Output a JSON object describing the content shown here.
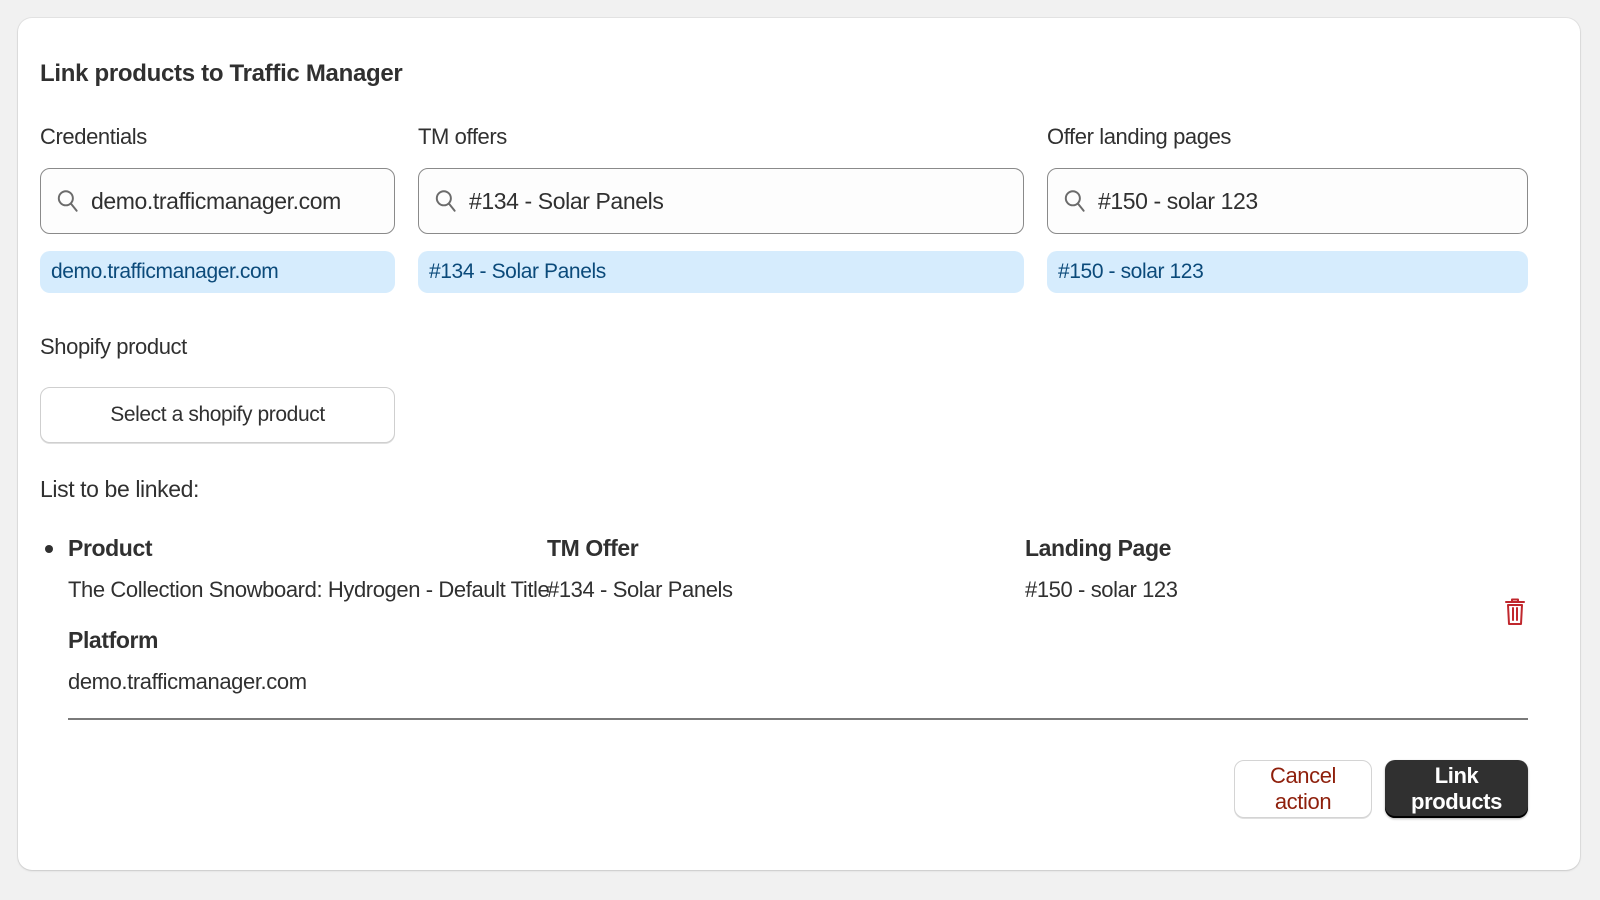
{
  "title": "Link products to Traffic Manager",
  "credentials": {
    "label": "Credentials",
    "search_value": "demo.trafficmanager.com",
    "selected_option": "demo.trafficmanager.com",
    "search_icon": "search-icon"
  },
  "tm_offers": {
    "label": "TM offers",
    "search_value": "#134 - Solar Panels",
    "selected_option": "#134 - Solar Panels",
    "search_icon": "search-icon"
  },
  "landing_pages": {
    "label": "Offer landing pages",
    "search_value": "#150 - solar 123",
    "selected_option": "#150 - solar 123",
    "search_icon": "search-icon"
  },
  "shopify_product": {
    "label": "Shopify product",
    "button_label": "Select a shopify product"
  },
  "link_list": {
    "title": "List to be linked:",
    "items": [
      {
        "product_header": "Product",
        "product": "The Collection Snowboard: Hydrogen - Default Title",
        "offer_header": "TM Offer",
        "offer": "#134 - Solar Panels",
        "landing_header": "Landing Page",
        "landing": "#150 - solar 123",
        "platform_header": "Platform",
        "platform": "demo.trafficmanager.com",
        "delete_icon": "trash-icon"
      }
    ]
  },
  "actions": {
    "cancel_label": "Cancel action",
    "submit_label": "Link products"
  },
  "colors": {
    "chip_background": "#d6ecfd",
    "chip_text": "#0b4a7a",
    "primary_button": "#303030",
    "critical_text": "#8e1f0b",
    "delete_icon": "#c0272d"
  }
}
